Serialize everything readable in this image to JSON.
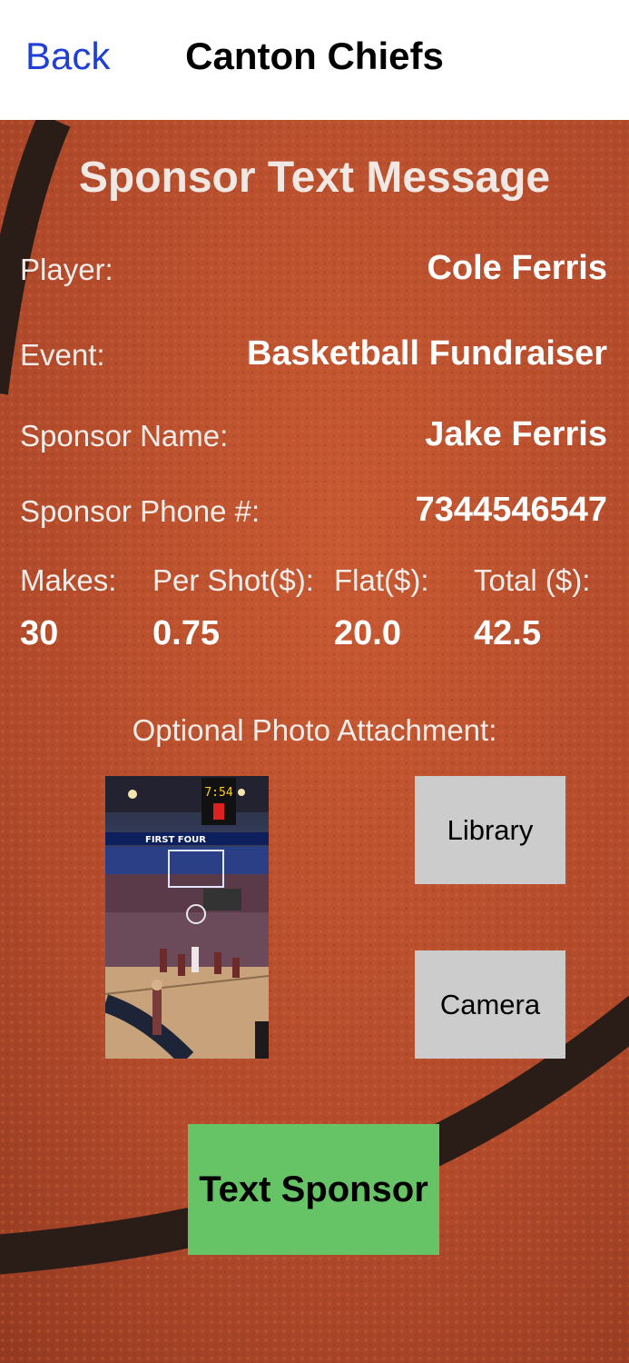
{
  "nav": {
    "back_label": "Back",
    "title": "Canton Chiefs"
  },
  "form": {
    "heading": "Sponsor Text Message",
    "rows": [
      {
        "label": "Player:",
        "value": "Cole Ferris"
      },
      {
        "label": "Event:",
        "value": "Basketball Fundraiser"
      },
      {
        "label": "Sponsor Name:",
        "value": "Jake Ferris"
      },
      {
        "label": "Sponsor Phone #:",
        "value": "7344546547"
      }
    ],
    "stats": [
      {
        "label": "Makes:",
        "value": "30"
      },
      {
        "label": "Per Shot($):",
        "value": "0.75"
      },
      {
        "label": "Flat($):",
        "value": "20.0"
      },
      {
        "label": "Total ($):",
        "value": "42.5"
      }
    ]
  },
  "photo": {
    "label": "Optional Photo Attachment:",
    "scoreboard_text": "7:54",
    "banner_text": "FIRST FOUR"
  },
  "buttons": {
    "library_label": "Library",
    "camera_label": "Camera",
    "send_label": "Text Sponsor"
  },
  "colors": {
    "nav_back": "#1f3fd6",
    "ball_orange": "#b54a2c",
    "seam": "#2a1d18",
    "gray_button": "#cccccc",
    "send_button": "#66c467"
  }
}
